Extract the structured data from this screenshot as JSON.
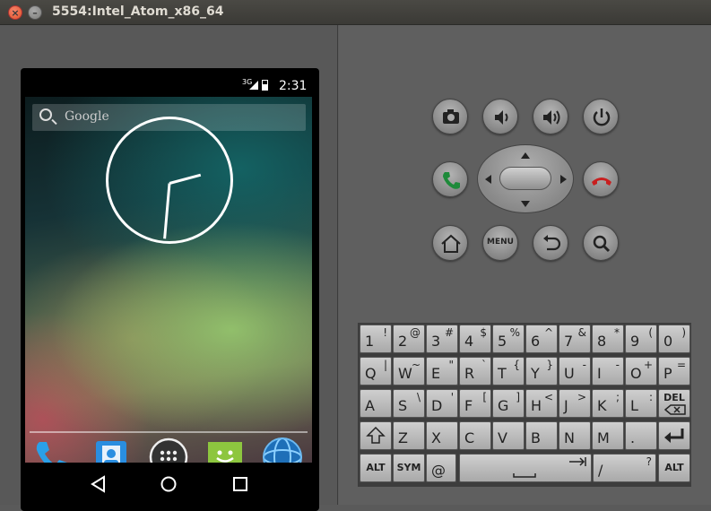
{
  "window": {
    "title": "5554:Intel_Atom_x86_64",
    "close_glyph": "×",
    "min_glyph": "–"
  },
  "status": {
    "network": "3G",
    "time": "2:31"
  },
  "search": {
    "placeholder": "Google"
  },
  "dock": {
    "items": [
      "phone-icon",
      "contacts-icon",
      "app-drawer-icon",
      "messaging-icon",
      "browser-icon"
    ]
  },
  "hardware": {
    "menu_label": "MENU",
    "buttons": [
      "camera-icon",
      "volume-down-icon",
      "volume-up-icon",
      "power-icon",
      "call-icon",
      "end-call-icon",
      "home-icon",
      "menu",
      "back-icon",
      "search-icon"
    ]
  },
  "keyboard": {
    "row1": [
      [
        "1",
        "!"
      ],
      [
        "2",
        "@"
      ],
      [
        "3",
        "#"
      ],
      [
        "4",
        "$"
      ],
      [
        "5",
        "%"
      ],
      [
        "6",
        "^"
      ],
      [
        "7",
        "&"
      ],
      [
        "8",
        "*"
      ],
      [
        "9",
        "("
      ],
      [
        "0",
        ")"
      ]
    ],
    "row2": [
      [
        "Q",
        "|"
      ],
      [
        "W",
        "~"
      ],
      [
        "E",
        "\""
      ],
      [
        "R",
        "`"
      ],
      [
        "T",
        "{"
      ],
      [
        "Y",
        "}"
      ],
      [
        "U",
        "-"
      ],
      [
        "I",
        "-"
      ],
      [
        "O",
        "+"
      ],
      [
        "P",
        "="
      ]
    ],
    "row3": [
      [
        "A",
        ""
      ],
      [
        "S",
        "\\"
      ],
      [
        "D",
        "'"
      ],
      [
        "F",
        "["
      ],
      [
        "G",
        "]"
      ],
      [
        "H",
        "<"
      ],
      [
        "J",
        ">"
      ],
      [
        "K",
        ";"
      ],
      [
        "L",
        ":"
      ]
    ],
    "del": "DEL",
    "row4": [
      "Z",
      "X",
      "C",
      "V",
      "B",
      "N",
      "M",
      "."
    ],
    "alt": "ALT",
    "sym": "SYM",
    "at": "@",
    "slash": "/",
    "question": "?"
  }
}
